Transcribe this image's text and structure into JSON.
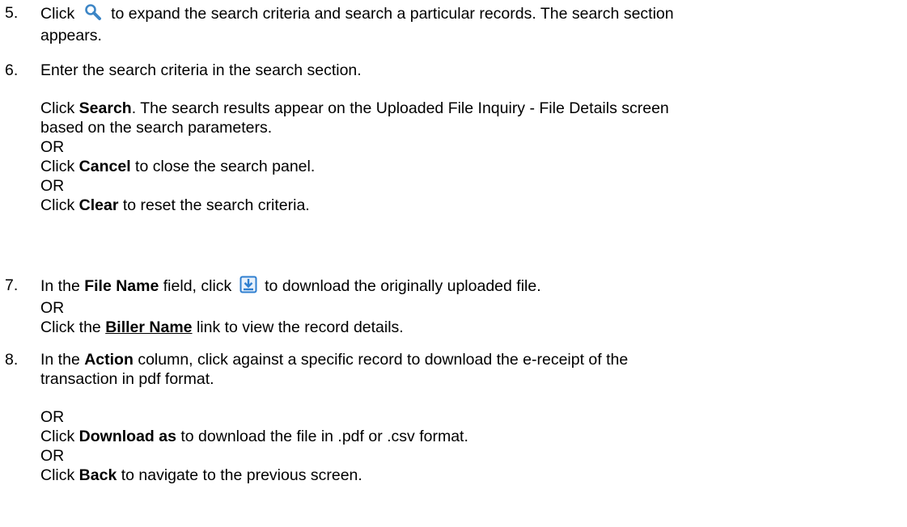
{
  "steps": [
    {
      "number": "5.",
      "lines": [
        {
          "pre": "Click",
          "post": "to expand the search criteria and search a particular records. The search section",
          "icon": "search-icon"
        },
        {
          "text": "appears."
        }
      ]
    },
    {
      "number": "6.",
      "intro": "Enter the search criteria in the search section.",
      "search": {
        "pre": "Click",
        "bold": "Search",
        "post": ". The search results appear on the Uploaded File Inquiry - File Details screen",
        "cont": "based on the search parameters."
      },
      "or1": "OR",
      "cancel": {
        "pre": "Click",
        "bold": "Cancel",
        "post": "to close the search panel."
      },
      "or2": "OR",
      "clear": {
        "pre": "Click",
        "bold": "Clear",
        "post": "to reset the search criteria."
      }
    },
    {
      "number": "7.",
      "file": {
        "pre": "In the",
        "bold": "File Name",
        "mid": "field, click",
        "post": "to download the originally uploaded file.",
        "icon": "download-icon"
      },
      "or1": "OR",
      "biller": {
        "pre": "Click the",
        "link": "Biller Name",
        "post": "link to view the record details."
      }
    },
    {
      "number": "8.",
      "action": {
        "pre": "In the",
        "bold": "Action",
        "post": "column, click  against a specific record to download the e-receipt of the",
        "cont": "transaction in pdf format."
      },
      "or1": "OR",
      "download": {
        "pre": "Click",
        "bold": "Download as",
        "post": "to download the file in .pdf or .csv format."
      },
      "or2": "OR",
      "back": {
        "pre": "Click",
        "bold": "Back",
        "post": "to navigate to the previous screen."
      }
    }
  ],
  "colors": {
    "search_icon": "#3d86c6",
    "download_icon": "#2f7fd0",
    "text": "#000000"
  }
}
